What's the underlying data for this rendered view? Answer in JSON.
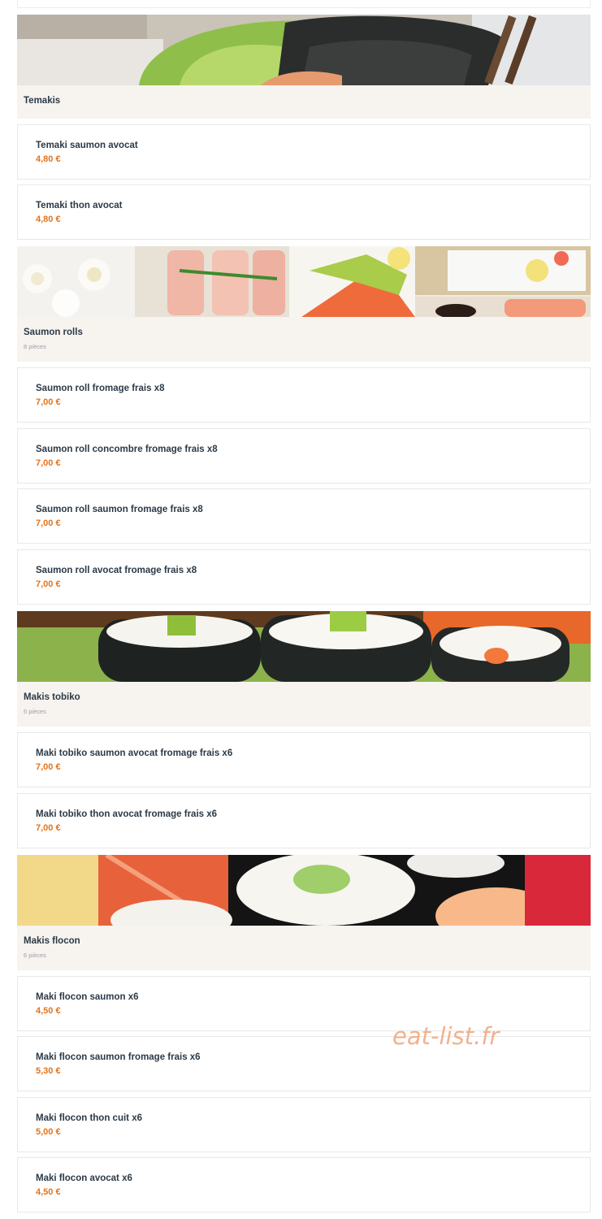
{
  "watermark": "eat-list.fr",
  "categories": [
    {
      "title": "Temakis",
      "subtitle": "",
      "image_icon": "temaki-photo",
      "items": [
        {
          "name": "Temaki saumon avocat",
          "price": "4,80 €"
        },
        {
          "name": "Temaki thon avocat",
          "price": "4,80 €"
        }
      ]
    },
    {
      "title": "Saumon rolls",
      "subtitle": "8 pièces",
      "image_icon": "salmon-rolls-photo",
      "items": [
        {
          "name": "Saumon roll fromage frais x8",
          "price": "7,00 €"
        },
        {
          "name": "Saumon roll concombre fromage frais x8",
          "price": "7,00 €"
        },
        {
          "name": "Saumon roll saumon fromage frais x8",
          "price": "7,00 €"
        },
        {
          "name": "Saumon roll avocat fromage frais x8",
          "price": "7,00 €"
        }
      ]
    },
    {
      "title": "Makis tobiko",
      "subtitle": "6 pièces",
      "image_icon": "maki-tobiko-photo",
      "items": [
        {
          "name": "Maki tobiko saumon avocat fromage frais x6",
          "price": "7,00 €"
        },
        {
          "name": "Maki tobiko thon avocat fromage frais x6",
          "price": "7,00 €"
        }
      ]
    },
    {
      "title": "Makis flocon",
      "subtitle": "6 pièces",
      "image_icon": "maki-flocon-photo",
      "items": [
        {
          "name": "Maki flocon saumon x6",
          "price": "4,50 €"
        },
        {
          "name": "Maki flocon saumon fromage frais x6",
          "price": "5,30 €"
        },
        {
          "name": "Maki flocon thon cuit x6",
          "price": "5,00 €"
        },
        {
          "name": "Maki flocon avocat x6",
          "price": "4,50 €"
        }
      ]
    }
  ]
}
